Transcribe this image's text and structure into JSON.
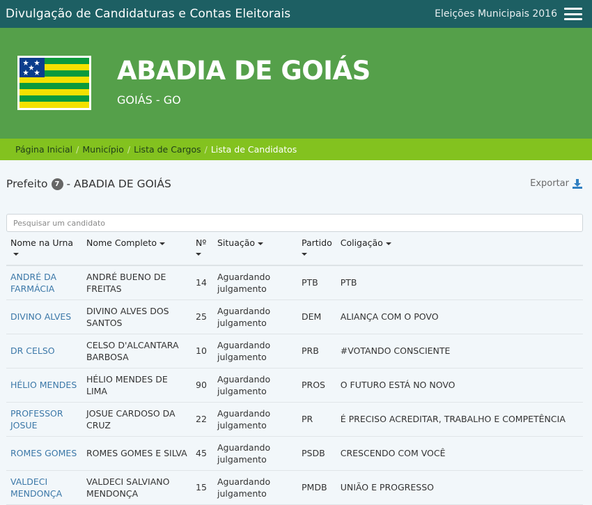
{
  "topbar": {
    "title": "Divulgação de Candidaturas e Contas Eleitorais",
    "election": "Eleições Municipais 2016"
  },
  "hero": {
    "city": "ABADIA DE GOIÁS",
    "state": "GOIÁS - GO",
    "flag_colors": {
      "green": "#0a9a3d",
      "yellow": "#f4e100",
      "blue": "#0b3d8c"
    }
  },
  "breadcrumb": {
    "items": [
      "Página Inicial",
      "Município",
      "Lista de Cargos"
    ],
    "current": "Lista de Candidatos"
  },
  "office": {
    "title": "Prefeito",
    "count": "7",
    "location": "- ABADIA DE GOIÁS"
  },
  "export_label": "Exportar",
  "search": {
    "placeholder": "Pesquisar um candidato"
  },
  "table": {
    "headers": [
      "Nome na Urna",
      "Nome Completo",
      "Nº",
      "Situação",
      "Partido",
      "Coligação"
    ],
    "rows": [
      [
        "ANDRÉ DA FARMÁCIA",
        "ANDRÉ BUENO DE FREITAS",
        "14",
        "Aguardando julgamento",
        "PTB",
        "PTB"
      ],
      [
        "DIVINO ALVES",
        "DIVINO ALVES DOS SANTOS",
        "25",
        "Aguardando julgamento",
        "DEM",
        "ALIANÇA COM O POVO"
      ],
      [
        "DR CELSO",
        "CELSO D'ALCANTARA BARBOSA",
        "10",
        "Aguardando julgamento",
        "PRB",
        "#VOTANDO CONSCIENTE"
      ],
      [
        "HÉLIO MENDES",
        "HÉLIO MENDES DE LIMA",
        "90",
        "Aguardando julgamento",
        "PROS",
        "O FUTURO ESTÁ NO NOVO"
      ],
      [
        "PROFESSOR JOSUE",
        "JOSUE CARDOSO DA CRUZ",
        "22",
        "Aguardando julgamento",
        "PR",
        "É PRECISO ACREDITAR, TRABALHO E COMPETÊNCIA"
      ],
      [
        "ROMES GOMES",
        "ROMES GOMES E SILVA",
        "45",
        "Aguardando julgamento",
        "PSDB",
        "CRESCENDO COM VOCÊ"
      ],
      [
        "VALDECI MENDONÇA",
        "VALDECI SALVIANO MENDONÇA",
        "15",
        "Aguardando julgamento",
        "PMDB",
        "UNIÃO E PROGRESSO"
      ]
    ]
  }
}
